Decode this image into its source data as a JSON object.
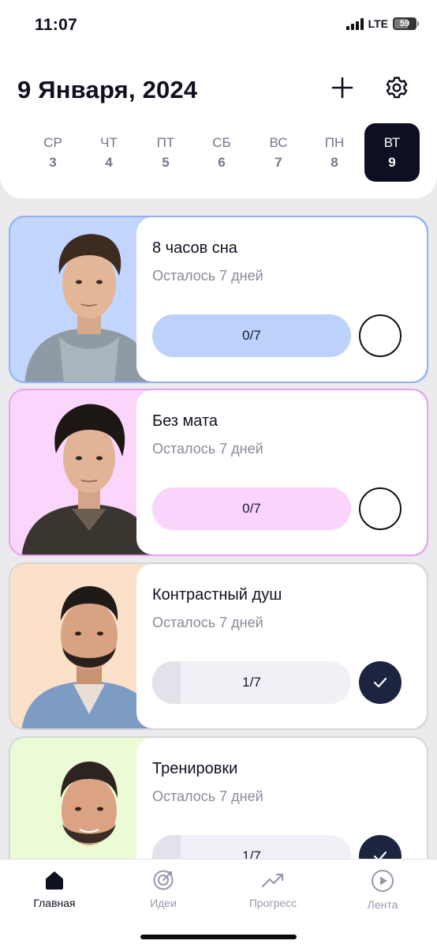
{
  "status_bar": {
    "time": "11:07",
    "network": "LTE",
    "battery": "59"
  },
  "header": {
    "title": "9 Января, 2024",
    "add_icon": "plus-icon",
    "settings_icon": "gear-icon"
  },
  "week": [
    {
      "name": "СР",
      "num": "3"
    },
    {
      "name": "ЧТ",
      "num": "4"
    },
    {
      "name": "ПТ",
      "num": "5"
    },
    {
      "name": "СБ",
      "num": "6"
    },
    {
      "name": "ВС",
      "num": "7"
    },
    {
      "name": "ПН",
      "num": "8"
    },
    {
      "name": "ВТ",
      "num": "9",
      "active": true
    }
  ],
  "habits": [
    {
      "title": "8 часов сна",
      "subtitle": "Осталось 7 дней",
      "progress": "0/7",
      "progress_fraction": 0,
      "done": false,
      "accent": "#bcd2fb",
      "border": "#8fb0f0",
      "photo_bg": "#c2d6fd"
    },
    {
      "title": "Без мата",
      "subtitle": "Осталось 7 дней",
      "progress": "0/7",
      "progress_fraction": 0,
      "done": false,
      "accent": "#f9d4fb",
      "border": "#ec9ef1",
      "photo_bg": "#fad6fc"
    },
    {
      "title": "Контрастный душ",
      "subtitle": "Осталось 7 дней",
      "progress": "1/7",
      "progress_fraction": 0.143,
      "done": true,
      "accent": "#e2e2ea",
      "border": "#d6d6d6",
      "photo_bg": "#fbe1c9"
    },
    {
      "title": "Тренировки",
      "subtitle": "Осталось 7 дней",
      "progress": "1/7",
      "progress_fraction": 0.143,
      "done": true,
      "accent": "#e2e2ea",
      "border": "#d6d6d6",
      "photo_bg": "#ebfbd6"
    }
  ],
  "tabs": [
    {
      "label": "Главная",
      "icon": "home-icon",
      "active": true
    },
    {
      "label": "Идеи",
      "icon": "target-icon",
      "active": false
    },
    {
      "label": "Прогресс",
      "icon": "trend-chart-icon",
      "active": false
    },
    {
      "label": "Лента",
      "icon": "play-icon",
      "active": false
    }
  ]
}
